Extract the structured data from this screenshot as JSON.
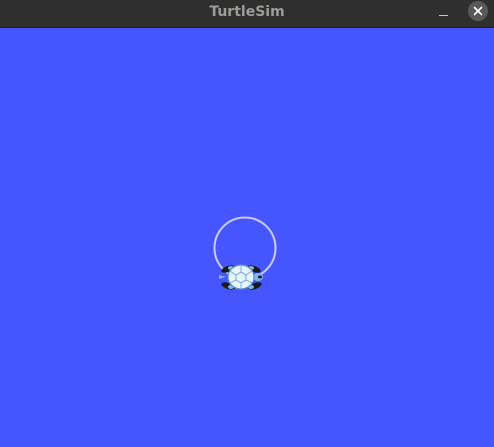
{
  "window": {
    "title": "TurtleSim",
    "minimize_icon": "minimize-icon",
    "close_icon": "close-icon"
  },
  "canvas": {
    "background_color": "#4556ff",
    "pen_color": "#c8ccff",
    "path_shape": "circle",
    "turtle_icon": "turtle-icon",
    "turtle_shell_color": "#e8f4ff",
    "turtle_limb_color": "#1a1a1a",
    "turtle_accent_color": "#7fb7e8"
  }
}
